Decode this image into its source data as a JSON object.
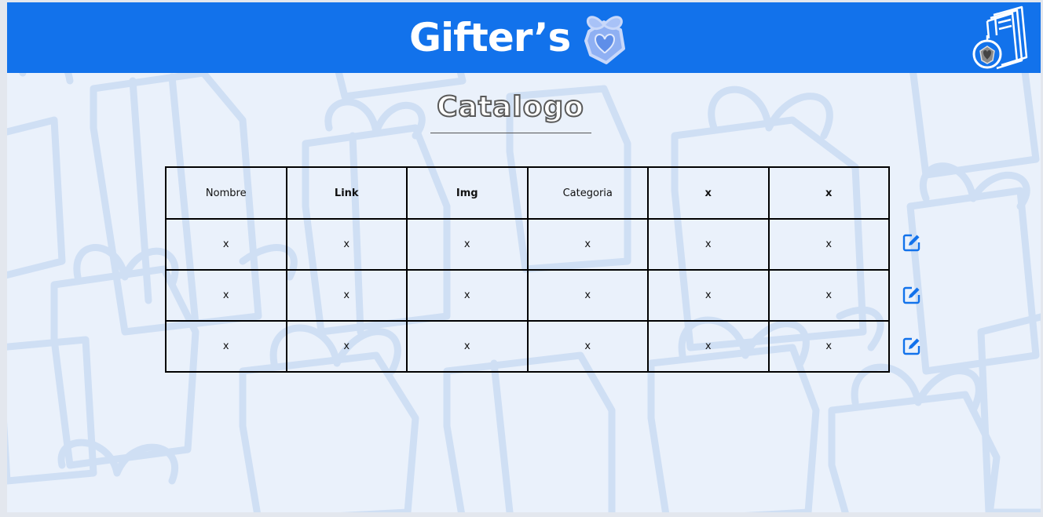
{
  "header": {
    "brand": "Gifter’s",
    "catalog_icon": "catalog-book-icon",
    "logo_icon": "gift-heart-icon"
  },
  "page": {
    "title": "Catalogo"
  },
  "table": {
    "columns": [
      {
        "label": "Nombre",
        "bold": false
      },
      {
        "label": "Link",
        "bold": true
      },
      {
        "label": "Img",
        "bold": true
      },
      {
        "label": "Categoria",
        "bold": false
      },
      {
        "label": "x",
        "bold": true
      },
      {
        "label": "x",
        "bold": true
      }
    ],
    "rows": [
      [
        "x",
        "x",
        "x",
        "x",
        "x",
        "x"
      ],
      [
        "x",
        "x",
        "x",
        "x",
        "x",
        "x"
      ],
      [
        "x",
        "x",
        "x",
        "x",
        "x",
        "x"
      ]
    ],
    "row_action_icon": "edit-icon"
  },
  "colors": {
    "header": "#1272eb",
    "background": "#eaf1fb",
    "pattern": "#c9daf2",
    "edit_icon": "#1272eb"
  }
}
